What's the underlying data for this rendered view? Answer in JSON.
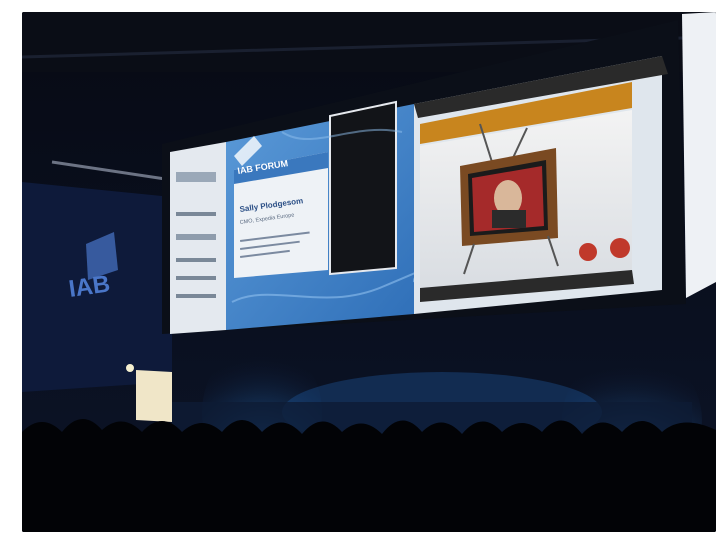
{
  "scene": {
    "description_type": "photo",
    "subject": "conference stage with large projection screens"
  },
  "screen_left": {
    "logo_text": "IAB",
    "speaker_name": "Sally Plodgesom",
    "speaker_role": "CMO, Expedia Europe"
  },
  "screen_center": {
    "logo_text": "IAB FORUM"
  },
  "wall_logo": {
    "text": "IAB"
  },
  "colors": {
    "screen_blue": "#3e7fc4",
    "panel_white": "#e9eef3",
    "stage_light": "#3aa0ff",
    "tv_orange": "#c8851e"
  }
}
